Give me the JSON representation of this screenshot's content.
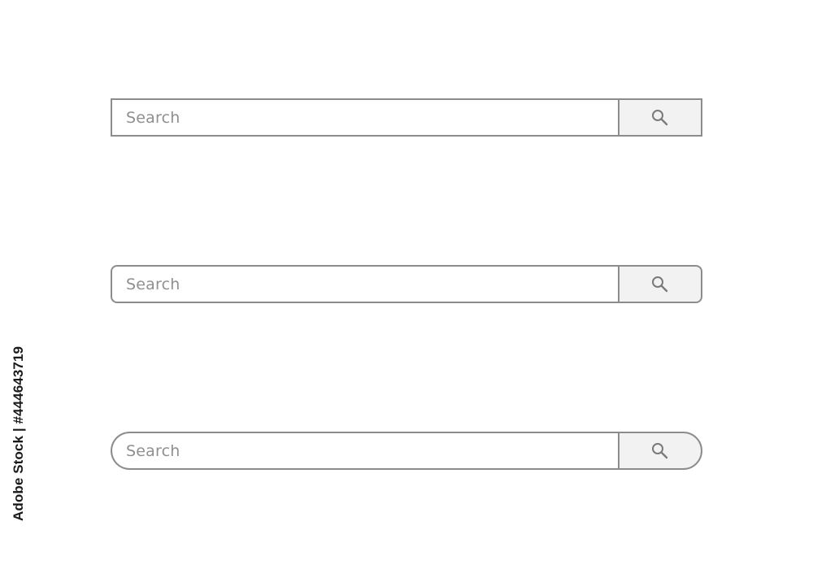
{
  "search_bars": [
    {
      "placeholder": "Search",
      "style": "square"
    },
    {
      "placeholder": "Search",
      "style": "rounded"
    },
    {
      "placeholder": "Search",
      "style": "pill"
    }
  ],
  "icon": "search-icon",
  "stock_id": "Adobe Stock | #444643719",
  "colors": {
    "border": "#8c8c8c",
    "button_bg": "#f1f2f1",
    "placeholder_text": "#8f8f8f",
    "icon": "#7a7a7a"
  }
}
